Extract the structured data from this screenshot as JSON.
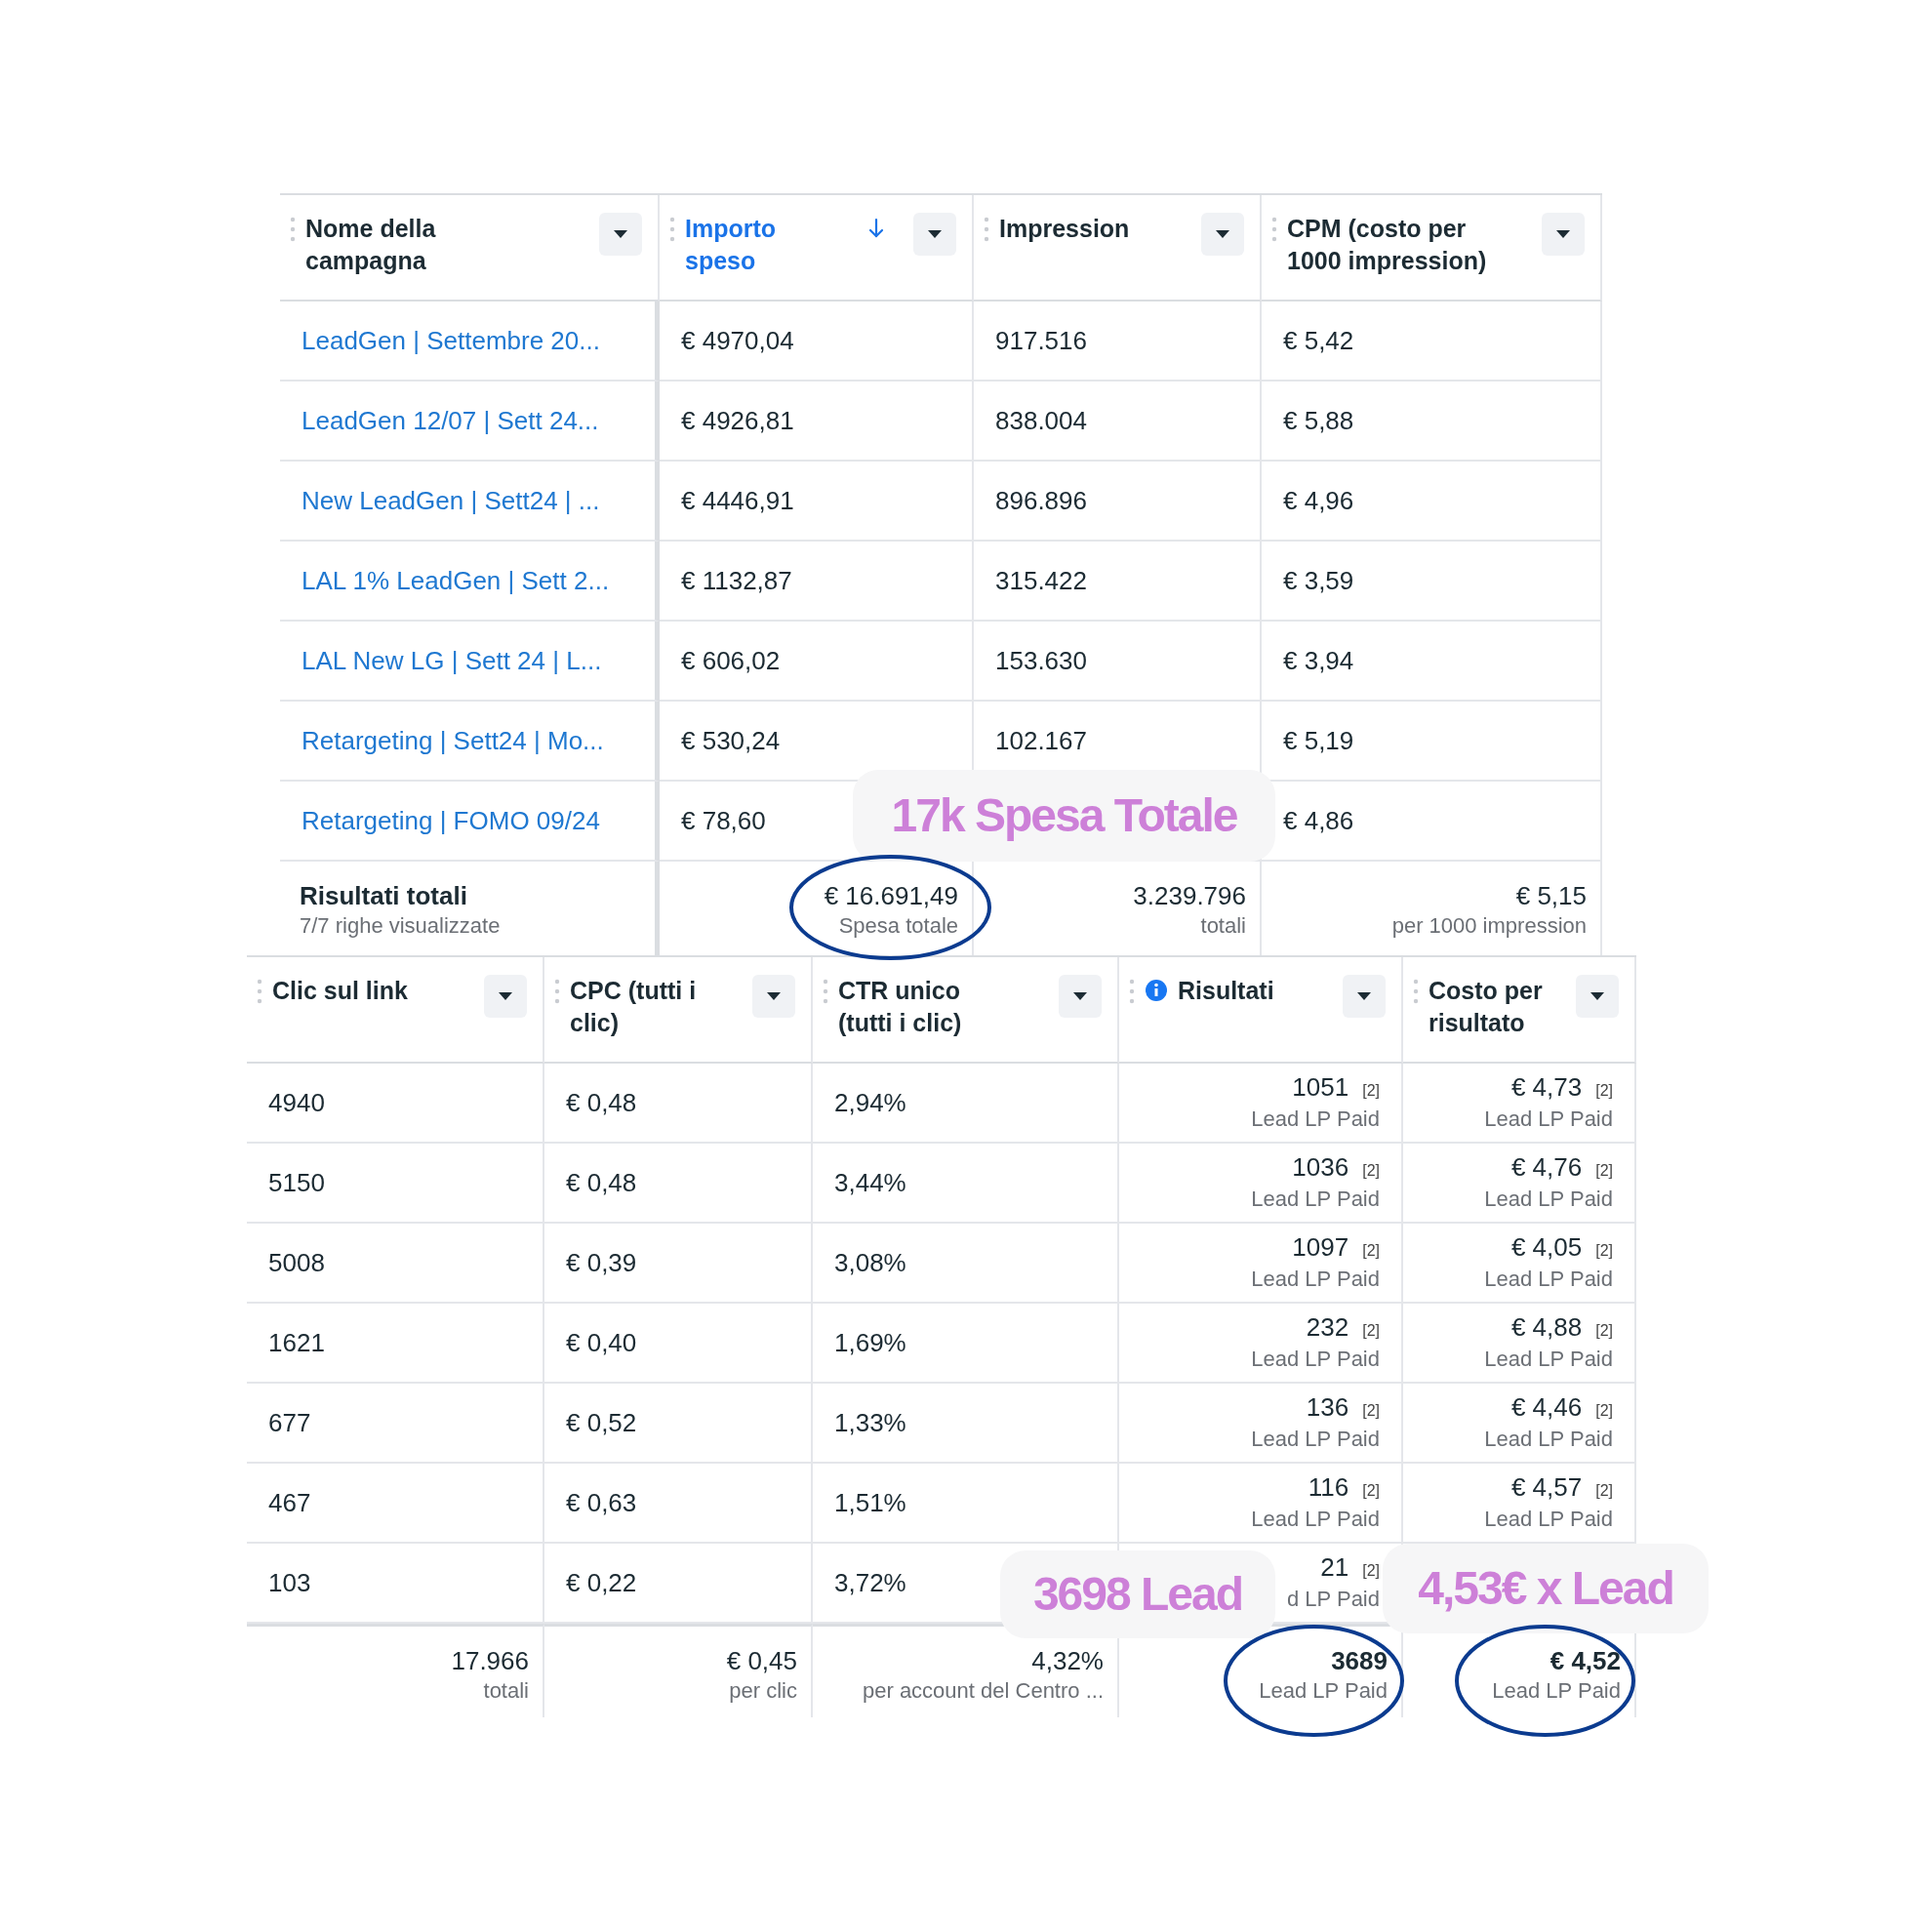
{
  "campaign_table": {
    "columns": [
      {
        "label": "Nome della campagna",
        "sorted": false,
        "kind": "link"
      },
      {
        "label": "Importo speso",
        "sorted": true,
        "kind": "text"
      },
      {
        "label": "Impression",
        "sorted": false,
        "kind": "text"
      },
      {
        "label": "CPM (costo per 1000 impression)",
        "sorted": false,
        "kind": "text"
      }
    ],
    "rows": [
      {
        "cells": [
          {
            "value": "LeadGen | Settembre 20..."
          },
          {
            "value": "€ 4970,04"
          },
          {
            "value": "917.516"
          },
          {
            "value": "€ 5,42"
          }
        ]
      },
      {
        "cells": [
          {
            "value": "LeadGen 12/07 | Sett 24..."
          },
          {
            "value": "€ 4926,81"
          },
          {
            "value": "838.004"
          },
          {
            "value": "€ 5,88"
          }
        ]
      },
      {
        "cells": [
          {
            "value": "New LeadGen | Sett24 | ..."
          },
          {
            "value": "€ 4446,91"
          },
          {
            "value": "896.896"
          },
          {
            "value": "€ 4,96"
          }
        ]
      },
      {
        "cells": [
          {
            "value": "LAL 1% LeadGen | Sett 2..."
          },
          {
            "value": "€ 1132,87"
          },
          {
            "value": "315.422"
          },
          {
            "value": "€ 3,59"
          }
        ]
      },
      {
        "cells": [
          {
            "value": "LAL New LG | Sett 24 | L..."
          },
          {
            "value": "€ 606,02"
          },
          {
            "value": "153.630"
          },
          {
            "value": "€ 3,94"
          }
        ]
      },
      {
        "cells": [
          {
            "value": "Retargeting | Sett24 | Mo..."
          },
          {
            "value": "€ 530,24"
          },
          {
            "value": "102.167"
          },
          {
            "value": "€ 5,19"
          }
        ]
      },
      {
        "cells": [
          {
            "value": "Retargeting | FOMO 09/24"
          },
          {
            "value": "€ 78,60"
          },
          {},
          {
            "value": "€ 4,86"
          }
        ]
      }
    ],
    "totals": [
      {
        "kind": "label",
        "value": "Risultati totali",
        "sub": "7/7 righe visualizzate",
        "bold": true
      },
      {
        "kind": "value",
        "value": "€ 16.691,49",
        "sub": "Spesa totale",
        "bold": false
      },
      {
        "kind": "value",
        "value": "3.239.796",
        "sub": "totali",
        "bold": false
      },
      {
        "kind": "value",
        "value": "€ 5,15",
        "sub": "per 1000 impression",
        "bold": false
      }
    ]
  },
  "metrics_table": {
    "columns": [
      {
        "label": "Clic sul link",
        "sorted": false,
        "info": false,
        "kind": "text"
      },
      {
        "label": "CPC (tutti i clic)",
        "sorted": false,
        "info": false,
        "kind": "text"
      },
      {
        "label": "CTR unico (tutti i clic)",
        "sorted": false,
        "info": false,
        "kind": "text"
      },
      {
        "label": "Risultati",
        "sorted": false,
        "info": true,
        "kind": "result"
      },
      {
        "label": "Costo per risultato",
        "sorted": false,
        "info": false,
        "kind": "result"
      }
    ],
    "rows": [
      {
        "cells": [
          {
            "value": "4940"
          },
          {
            "value": "€ 0,48"
          },
          {
            "value": "2,94%"
          },
          {
            "value": "1051",
            "tag": "[2]",
            "sub": "Lead LP Paid"
          },
          {
            "value": "€ 4,73",
            "tag": "[2]",
            "sub": "Lead LP Paid"
          }
        ]
      },
      {
        "cells": [
          {
            "value": "5150"
          },
          {
            "value": "€ 0,48"
          },
          {
            "value": "3,44%"
          },
          {
            "value": "1036",
            "tag": "[2]",
            "sub": "Lead LP Paid"
          },
          {
            "value": "€ 4,76",
            "tag": "[2]",
            "sub": "Lead LP Paid"
          }
        ]
      },
      {
        "cells": [
          {
            "value": "5008"
          },
          {
            "value": "€ 0,39"
          },
          {
            "value": "3,08%"
          },
          {
            "value": "1097",
            "tag": "[2]",
            "sub": "Lead LP Paid"
          },
          {
            "value": "€ 4,05",
            "tag": "[2]",
            "sub": "Lead LP Paid"
          }
        ]
      },
      {
        "cells": [
          {
            "value": "1621"
          },
          {
            "value": "€ 0,40"
          },
          {
            "value": "1,69%"
          },
          {
            "value": "232",
            "tag": "[2]",
            "sub": "Lead LP Paid"
          },
          {
            "value": "€ 4,88",
            "tag": "[2]",
            "sub": "Lead LP Paid"
          }
        ]
      },
      {
        "cells": [
          {
            "value": "677"
          },
          {
            "value": "€ 0,52"
          },
          {
            "value": "1,33%"
          },
          {
            "value": "136",
            "tag": "[2]",
            "sub": "Lead LP Paid"
          },
          {
            "value": "€ 4,46",
            "tag": "[2]",
            "sub": "Lead LP Paid"
          }
        ]
      },
      {
        "cells": [
          {
            "value": "467"
          },
          {
            "value": "€ 0,63"
          },
          {
            "value": "1,51%"
          },
          {
            "value": "116",
            "tag": "[2]",
            "sub": "Lead LP Paid"
          },
          {
            "value": "€ 4,57",
            "tag": "[2]",
            "sub": "Lead LP Paid"
          }
        ]
      },
      {
        "cells": [
          {
            "value": "103"
          },
          {
            "value": "€ 0,22"
          },
          {
            "value": "3,72%"
          },
          {
            "value": "21",
            "tag": "[2]",
            "sub": "d LP Paid"
          },
          {}
        ]
      }
    ],
    "totals": [
      {
        "kind": "value",
        "value": "17.966",
        "sub": "totali",
        "bold": false
      },
      {
        "kind": "value",
        "value": "€ 0,45",
        "sub": "per clic",
        "bold": false
      },
      {
        "kind": "value",
        "value": "4,32%",
        "sub": "per account del Centro ...",
        "bold": false
      },
      {
        "kind": "value",
        "value": "3689",
        "sub": "Lead LP Paid",
        "bold": true
      },
      {
        "kind": "value",
        "value": "€ 4,52",
        "sub": "Lead LP Paid",
        "bold": true
      }
    ]
  },
  "callouts": [
    "17k Spesa Totale",
    "3698 Lead",
    "4,53€ x Lead"
  ]
}
